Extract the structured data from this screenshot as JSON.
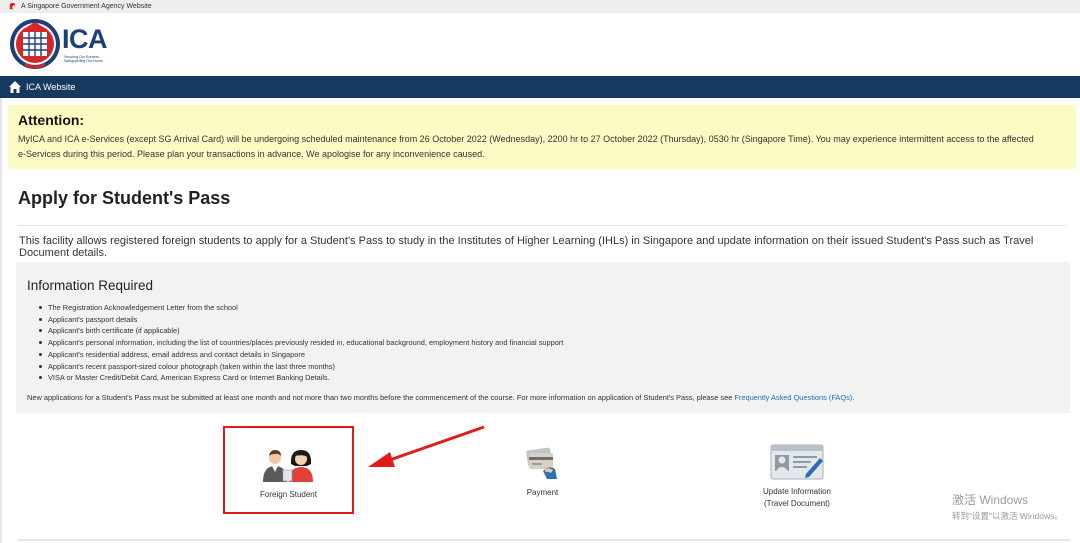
{
  "gov_bar": {
    "text": "A Singapore Government Agency Website"
  },
  "brand": {
    "name": "ICA",
    "tagline_line1": "Securing Our Borders,",
    "tagline_line2": "Safeguarding Our Home"
  },
  "nav": {
    "home_label": "ICA Website"
  },
  "attention": {
    "heading": "Attention:",
    "line1": "MyICA and ICA e-Services (except SG Arrival Card) will be undergoing scheduled maintenance from 26 October 2022 (Wednesday), 2200 hr to 27 October 2022 (Thursday), 0530 hr (Singapore Time). You may experience intermittent access to the affected",
    "line2": "e-Services during this period. Please plan your transactions in advance. We apologise for any inconvenience caused."
  },
  "page": {
    "title": "Apply for Student's Pass",
    "intro": "This facility allows registered foreign students to apply for a Student's Pass to study in the Institutes of Higher Learning (IHLs) in Singapore and update information on their issued Student's Pass such as Travel Document details."
  },
  "info": {
    "heading": "Information Required",
    "items": [
      "The Registration Acknowledgement Letter from the school",
      "Applicant's passport details",
      "Applicant's birth certificate (if applicable)",
      "Applicant's personal information, including the list of countries/places previously resided in, educational background, employment history and financial support",
      "Applicant's residential address, email address and contact details in Singapore",
      "Applicant's recent passport-sized colour photograph (taken within the last three months)",
      "VISA or Master Credit/Debit Card, American Express Card or Internet Banking Details."
    ],
    "note": "New applications for a Student's Pass must be submitted at least one month and not more than two months before the commencement of the course. For more information on application of Student's Pass, please see ",
    "faq_link": "Frequently Asked Questions (FAQs)",
    "note_end": "."
  },
  "tiles": {
    "foreign_student": "Foreign Student",
    "payment": "Payment",
    "update_line1": "Update Information",
    "update_line2": "(Travel Document)"
  },
  "watermark": {
    "line1": "激活 Windows",
    "line2": "转到\"设置\"以激活 Windows。"
  },
  "colors": {
    "nav_bg": "#163a5f",
    "attention_bg": "#fdfbc4",
    "brand_blue": "#1d3f7a",
    "highlight_red": "#e01b1b",
    "link_blue": "#1a6fb5"
  }
}
